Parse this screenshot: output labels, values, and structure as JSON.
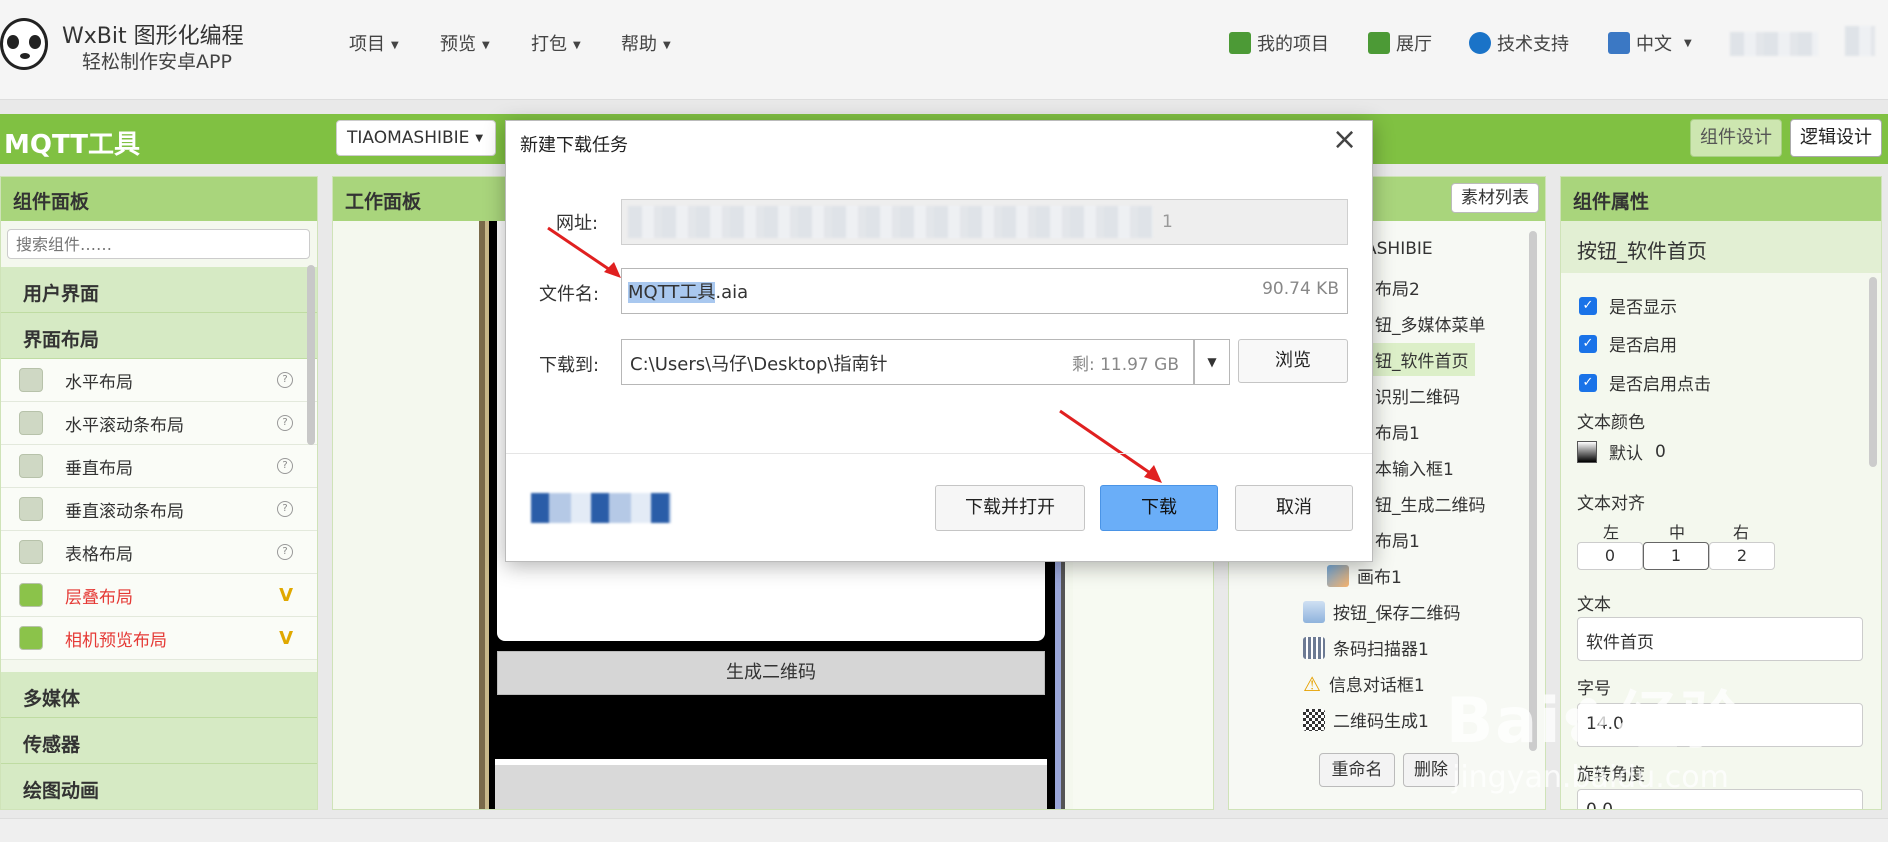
{
  "header": {
    "brand_title": "WxBit 图形化编程",
    "brand_sub": "轻松制作安卓APP",
    "menus": [
      "项目",
      "预览",
      "打包",
      "帮助"
    ],
    "links": {
      "my_projects": "我的项目",
      "gallery": "展厅",
      "support": "技术支持",
      "language": "中文"
    }
  },
  "project_bar": {
    "project_name": "MQTT工具",
    "screen_select": "TIAOMASHIBIE",
    "material_list": "素材列表",
    "component_design": "组件设计",
    "logic_design": "逻辑设计"
  },
  "palette": {
    "title": "组件面板",
    "search_placeholder": "搜索组件……",
    "categories_top": [
      "用户界面",
      "界面布局"
    ],
    "items": [
      {
        "label": "水平布局",
        "mark": "?"
      },
      {
        "label": "水平滚动条布局",
        "mark": "?"
      },
      {
        "label": "垂直布局",
        "mark": "?"
      },
      {
        "label": "垂直滚动条布局",
        "mark": "?"
      },
      {
        "label": "表格布局",
        "mark": "?"
      },
      {
        "label": "层叠布局",
        "mark": "V"
      },
      {
        "label": "相机预览布局",
        "mark": "V"
      }
    ],
    "categories_bottom": [
      "多媒体",
      "传感器",
      "绘图动画"
    ]
  },
  "workspace": {
    "title": "工作面板",
    "generate_qr_button": "生成二维码"
  },
  "tree": {
    "items": [
      "ASHIBIE",
      "布局2",
      "钮_多媒体菜单",
      "钮_软件首页",
      "识别二维码",
      "布局1",
      "本输入框1",
      "钮_生成二维码",
      "布局1",
      "画布1",
      "按钮_保存二维码",
      "条码扫描器1",
      "信息对话框1",
      "二维码生成1"
    ],
    "rename_button": "重命名",
    "delete_button": "删除"
  },
  "properties": {
    "title": "组件属性",
    "component_name": "按钮_软件首页",
    "checkboxes": [
      "是否显示",
      "是否启用",
      "是否启用点击"
    ],
    "text_color_label": "文本颜色",
    "text_color_value": "默认",
    "text_color_num": "0",
    "align_label": "文本对齐",
    "align_options": [
      "左",
      "中",
      "右"
    ],
    "align_values": [
      "0",
      "1",
      "2"
    ],
    "text_label": "文本",
    "text_value": "软件首页",
    "font_size_label": "字号",
    "font_size_value": "14.0",
    "rotation_label": "旋转角度",
    "rotation_value": "0.0"
  },
  "dialog": {
    "title": "新建下载任务",
    "url_label": "网址:",
    "url_tail": "1",
    "filename_label": "文件名:",
    "filename_selected": "MQTT工具",
    "filename_ext": ".aia",
    "filesize": "90.74 KB",
    "saveto_label": "下载到:",
    "saveto_path": "C:\\Users\\马仔\\Desktop\\指南针",
    "free_space": "剩: 11.97 GB",
    "browse_button": "浏览",
    "download_open_button": "下载并打开",
    "download_button": "下载",
    "cancel_button": "取消"
  },
  "watermark": {
    "text": "经验",
    "url": "jingyan.baidu.com"
  },
  "colors": {
    "green": "#80c142",
    "panel_head": "#a9d57c",
    "highlight_text": "#e53935",
    "download_btn": "#6aaef8"
  }
}
